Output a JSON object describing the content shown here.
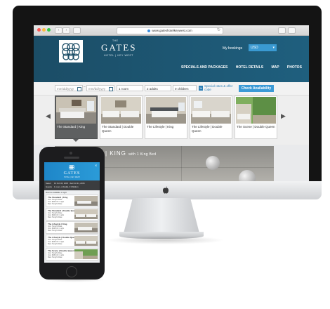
{
  "browser": {
    "url": "www.gateshotelkeywest.com"
  },
  "site": {
    "brand_the": "THE",
    "brand_name": "GATES",
    "brand_sub": "HOTEL | KEY WEST",
    "my_bookings": "My bookings",
    "currency": "USD",
    "nav": [
      "SPECIALS AND PACKAGES",
      "HOTEL DETAILS",
      "MAP",
      "PHOTOS"
    ]
  },
  "booking": {
    "checkin_placeholder": "mm/dd/yyyy",
    "checkout_placeholder": "mm/dd/yyyy",
    "rooms": "1 room",
    "adults": "2 adults",
    "children": "0 children",
    "promo_badge": "%",
    "promo": "Special rates & offer code",
    "check_button": "Check Availability"
  },
  "rooms": [
    {
      "label": "The Standard | King",
      "active": true
    },
    {
      "label": "The Standard | Double Queen",
      "active": false
    },
    {
      "label": "The Lifestyle | King",
      "active": false
    },
    {
      "label": "The Lifestyle | Double Queen",
      "active": false
    },
    {
      "label": "The Scene | Double Queen",
      "active": false
    }
  ],
  "hero": {
    "title": "| KING",
    "subtitle": "with 1 King Bed"
  },
  "phone": {
    "brand": "GATES",
    "sub": "HOTEL | KEY WEST",
    "search_dates": "Fri Oct 30, 2015 - Sat Oct 31, 2015",
    "search_guests": "1 room, 2 Adults, 0 Children",
    "select": "Select",
    "guests": "Guests",
    "rooms_heading": "Rooms available 1 night",
    "rooms": [
      {
        "name": "The Standard | King",
        "from": "from Tonight Rate",
        "rate": "from $303.00 / night",
        "rate2": "Best Tonight Rate"
      },
      {
        "name": "The Standard | Double Queen",
        "from": "from Tonight Rate",
        "rate": "from $303.00 / night",
        "rate2": "Best Tonight Rate"
      },
      {
        "name": "The Lifestyle | King",
        "from": "from Tonight Rate",
        "rate": "from $333.00 / night",
        "rate2": "Best Tonight Rate"
      },
      {
        "name": "The Lifestyle | Double Queen",
        "from": "from Tonight Rate",
        "rate": "from $333.00 / night",
        "rate2": "Best Tonight Rate"
      },
      {
        "name": "The Scene | Double Queen",
        "from": "from Tonight Rate",
        "rate": "from $353.00 / night",
        "rate2": "Best Tonight Rate"
      }
    ]
  }
}
